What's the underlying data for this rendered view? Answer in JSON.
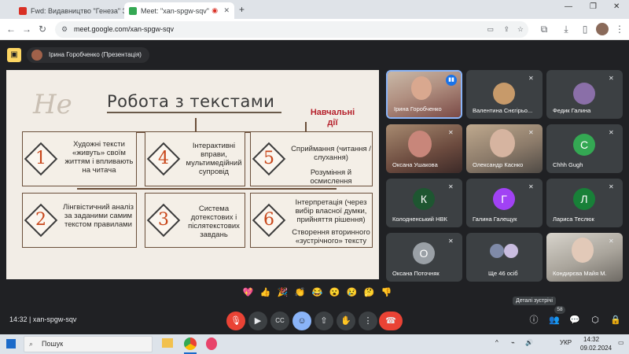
{
  "browser": {
    "tabs": [
      {
        "label": "Fwd: Видавництво \"Генеза\" З",
        "favicon_color": "#d93025",
        "active": false
      },
      {
        "label": "Meet: \"xan-spgw-sqv\"",
        "favicon_color": "#34a853",
        "active": true
      }
    ],
    "new_tab_label": "+",
    "url": "meet.google.com/xan-spgw-sqv"
  },
  "meet": {
    "presenter_chip": "Ірина Горобченко (Презентація)",
    "slide": {
      "title": "Робота з текстами",
      "side_label": "Навчальні дії",
      "cards": [
        {
          "num": "1",
          "text": "Художні тексти «живуть» своїм життям і впливають на читача"
        },
        {
          "num": "4",
          "text": "Інтерактивні вправи, мультимедійний супровід"
        },
        {
          "num": "5",
          "text": "Сприймання (читання / слухання)",
          "text2": "Розуміння й осмислення"
        },
        {
          "num": "2",
          "text": "Лінгвістичний аналіз за заданими самим текстом правилами"
        },
        {
          "num": "3",
          "text": "Система дотекстових і післятекстових завдань"
        },
        {
          "num": "6",
          "text": "Інтерпретація (через вибір власної думки, прийняття рішення)",
          "text2": "Створення вторинного «зустрічного» тексту"
        }
      ]
    },
    "participants": [
      {
        "name": "Ірина Горобченко",
        "kind": "video"
      },
      {
        "name": "Валентина Снєгірьо...",
        "kind": "photo"
      },
      {
        "name": "Федик Галина",
        "kind": "photo"
      },
      {
        "name": "Оксана Ушакова",
        "kind": "video"
      },
      {
        "name": "Олександр Каснко",
        "kind": "video"
      },
      {
        "name": "Chhh Gugh",
        "kind": "letter",
        "letter": "C",
        "color": "#34a853"
      },
      {
        "name": "Колодненський НВК",
        "kind": "letter",
        "letter": "К",
        "color": "#1e5631"
      },
      {
        "name": "Галина Галещук",
        "kind": "letter",
        "letter": "Г",
        "color": "#a142f4"
      },
      {
        "name": "Лариса Теслюк",
        "kind": "letter",
        "letter": "Л",
        "color": "#188038"
      },
      {
        "name": "Оксана Поточняк",
        "kind": "letter",
        "letter": "О",
        "color": "#9aa0a6"
      },
      {
        "name": "Ще 46 осіб",
        "kind": "group"
      },
      {
        "name": "Кондирєва Майя М.",
        "kind": "video"
      }
    ],
    "reactions": [
      "💖",
      "👍",
      "🎉",
      "👏",
      "😂",
      "😮",
      "😢",
      "🤔",
      "👎"
    ],
    "meeting_code": "14:32  |  xan-spgw-sqv",
    "tooltip": "Деталі зустрічі",
    "people_count": "58"
  },
  "taskbar": {
    "search_label": "Пошук",
    "lang": "УКР",
    "time": "14:32",
    "date": "09.02.2024"
  }
}
